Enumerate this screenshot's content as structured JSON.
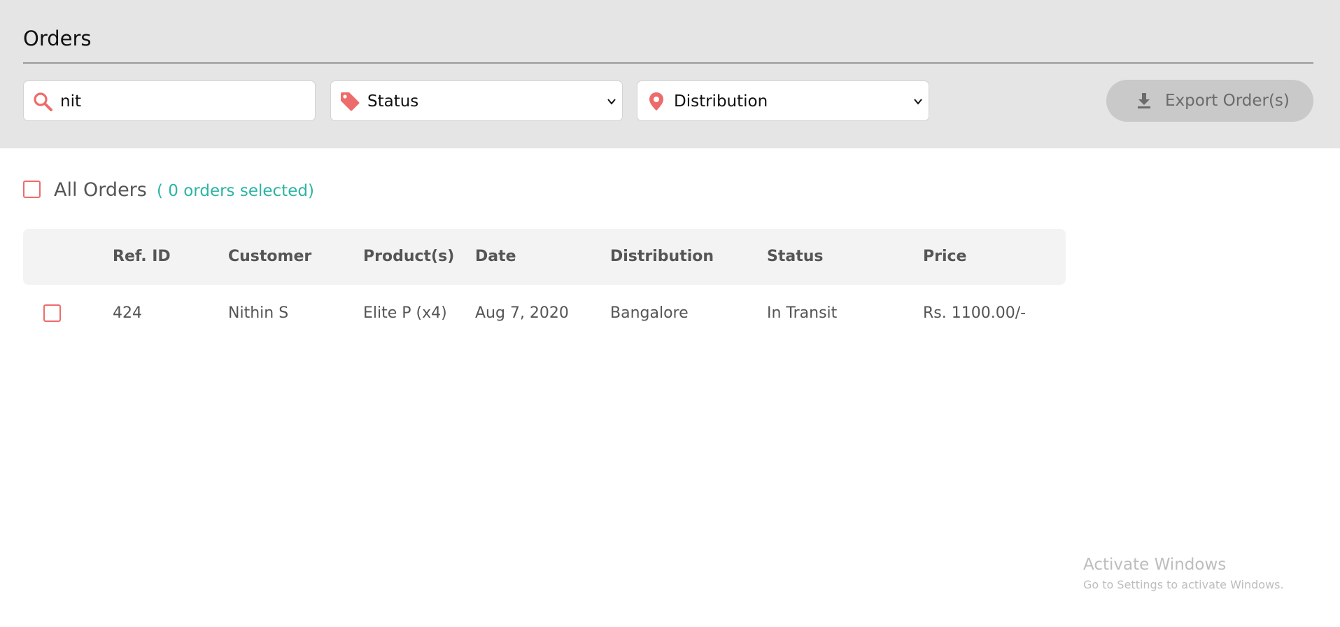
{
  "header": {
    "title": "Orders"
  },
  "filters": {
    "search": {
      "icon": "search-icon",
      "value": "nit"
    },
    "status": {
      "icon": "tag-icon",
      "label": "Status"
    },
    "distribution": {
      "icon": "location-pin-icon",
      "label": "Distribution"
    },
    "export": {
      "icon": "download-icon",
      "label": "Export Order(s)"
    }
  },
  "selection": {
    "label": "All Orders",
    "count_text": "( 0 orders selected)",
    "checked": false
  },
  "table": {
    "columns": [
      "Ref. ID",
      "Customer",
      "Product(s)",
      "Date",
      "Distribution",
      "Status",
      "Price"
    ],
    "rows": [
      {
        "checked": false,
        "ref_id": "424",
        "customer": "Nithin S",
        "products": "Elite P (x4)",
        "date": "Aug 7, 2020",
        "distribution": "Bangalore",
        "status": "In Transit",
        "price": "Rs. 1100.00/-"
      }
    ]
  },
  "watermark": {
    "title": "Activate Windows",
    "subtitle": "Go to Settings to activate Windows."
  },
  "colors": {
    "accent_red": "#ee6b6b",
    "teal": "#2bb4a3",
    "header_band": "#e5e5e5",
    "export_button": "#c9c9c9"
  }
}
